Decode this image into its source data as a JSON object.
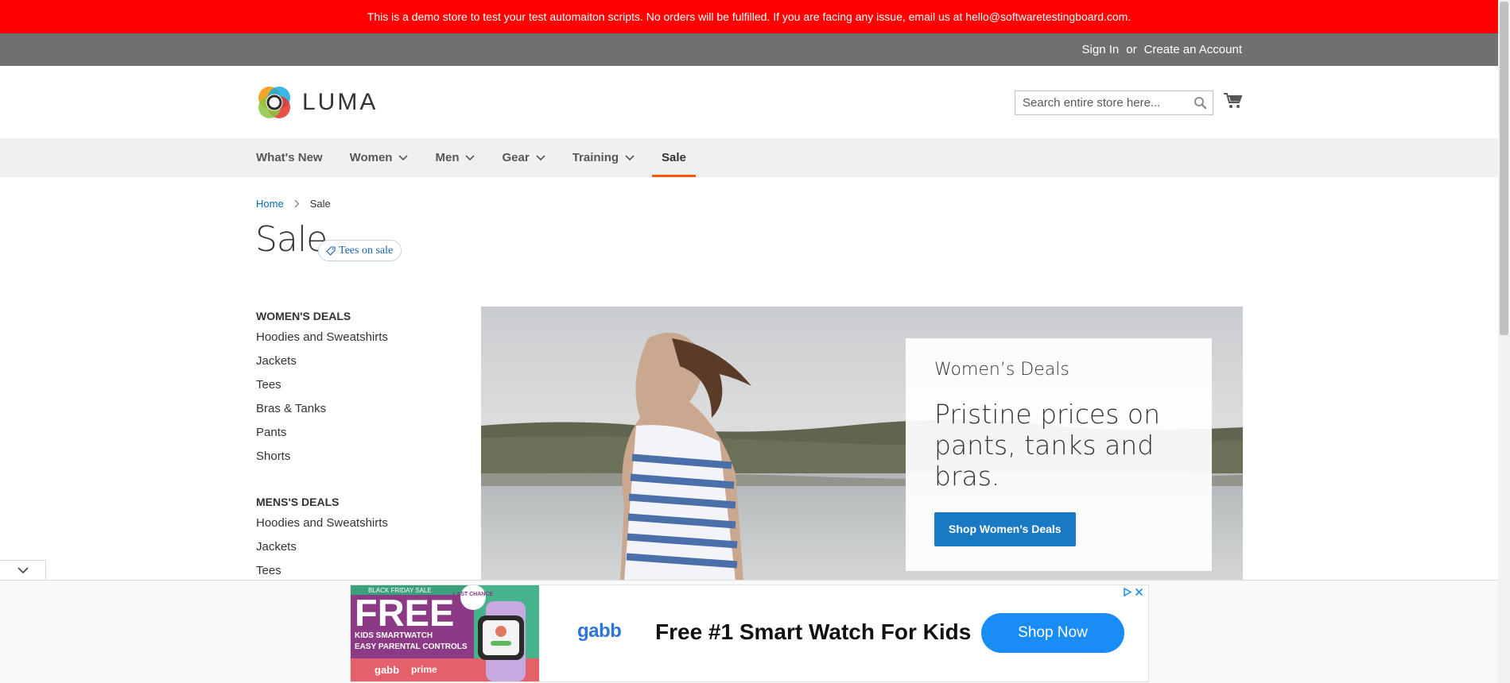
{
  "demo_banner": {
    "text": "This is a demo store to test your test automaiton scripts. No orders will be fulfilled. If you are facing any issue, email us at hello@softwaretestingboard.com."
  },
  "header": {
    "sign_in": "Sign In",
    "separator": "or",
    "create_account": "Create an Account"
  },
  "logo": {
    "text": "LUMA"
  },
  "search": {
    "placeholder": "Search entire store here..."
  },
  "nav": {
    "items": [
      {
        "label": "What's New"
      },
      {
        "label": "Women"
      },
      {
        "label": "Men"
      },
      {
        "label": "Gear"
      },
      {
        "label": "Training"
      },
      {
        "label": "Sale"
      }
    ],
    "active": "Sale"
  },
  "breadcrumb": {
    "home": "Home",
    "current": "Sale"
  },
  "page": {
    "title": "Sale",
    "tag": "Tees on sale"
  },
  "sidebar": {
    "sections": [
      {
        "title": "WOMEN'S DEALS",
        "items": [
          "Hoodies and Sweatshirts",
          "Jackets",
          "Tees",
          "Bras & Tanks",
          "Pants",
          "Shorts"
        ]
      },
      {
        "title": "MENS'S DEALS",
        "items": [
          "Hoodies and Sweatshirts",
          "Jackets",
          "Tees"
        ]
      }
    ]
  },
  "hero": {
    "subtitle": "Women’s Deals",
    "headline": "Pristine prices on pants, tanks and bras.",
    "button": "Shop Women’s Deals"
  },
  "ad": {
    "image_text": {
      "sale": "BLACK FRIDAY SALE",
      "free": "FREE",
      "last_chance": "LAST CHANCE",
      "line1": "KIDS SMARTWATCH",
      "line2": "EASY PARENTAL CONTROLS",
      "brand1": "gabb",
      "brand2": "prime"
    },
    "brand": "gabb",
    "headline": "Free #1 Smart Watch For Kids",
    "cta": "Shop Now"
  },
  "colors": {
    "banner": "#ff0101",
    "panel": "#6e716e",
    "nav_bg": "#f0f0f0",
    "accent": "#ff5501",
    "link": "#006bb4",
    "button": "#1979c3",
    "ad_cta": "#1a8cf5"
  },
  "icons": [
    "search-icon",
    "cart-icon",
    "chevron-down-icon",
    "tag-icon",
    "adchoices-icon",
    "close-icon"
  ]
}
